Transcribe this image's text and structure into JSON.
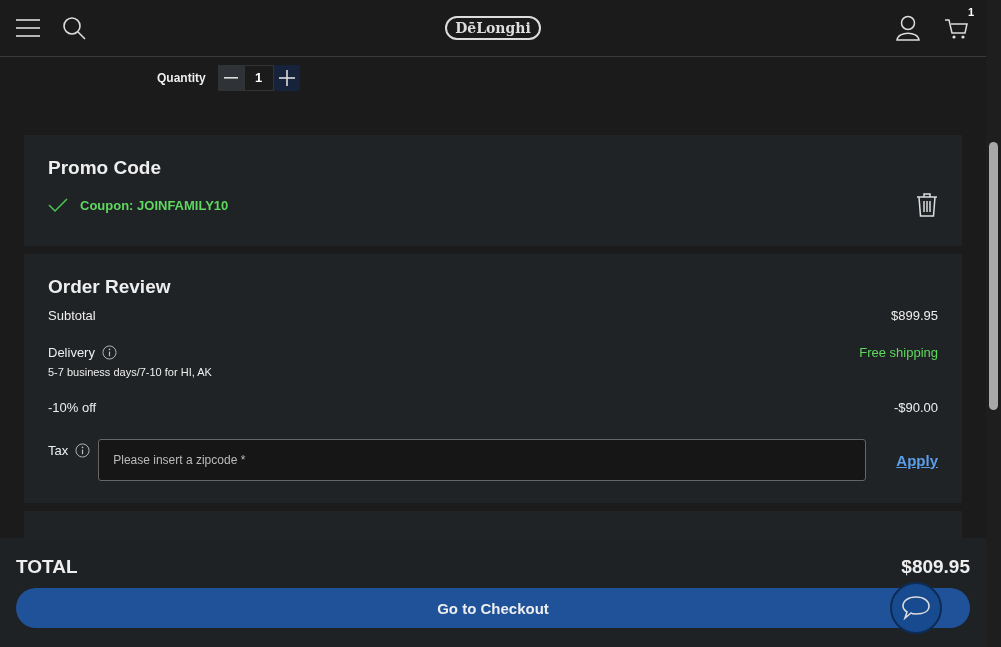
{
  "header": {
    "logo": "DēLonghi",
    "cart_count": "1"
  },
  "quantity": {
    "label": "Quantity",
    "value": "1"
  },
  "promo": {
    "title": "Promo Code",
    "coupon": "Coupon: JOINFAMILY10",
    "applied": true
  },
  "order_review": {
    "title": "Order Review",
    "rows": [
      {
        "kind": "amount",
        "label": "Subtotal",
        "value": "$899.95"
      },
      {
        "kind": "delivery",
        "label": "Delivery",
        "note": "5-7 business days/7-10 for HI, AK",
        "value": "Free shipping"
      },
      {
        "kind": "amount",
        "label": "-10% off",
        "value": "-$90.00"
      }
    ],
    "tax": {
      "label": "Tax",
      "placeholder": "Please insert a zipcode *",
      "action": "Apply"
    }
  },
  "footer": {
    "total_label": "TOTAL",
    "total_value": "$809.95",
    "checkout": "Go to Checkout"
  }
}
